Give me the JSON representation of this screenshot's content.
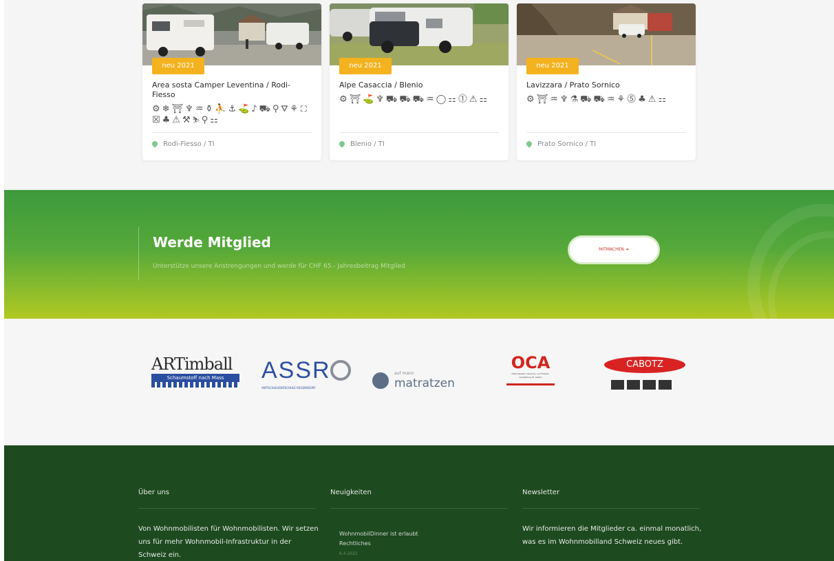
{
  "cards": [
    {
      "badge": "neu 2021",
      "title": "Area sosta Camper Leventina / Rodi-Fiesso",
      "icons": "⚙❄⛩♆♒⚱⛹⚓⛳♪⛟⚲⛛⚘⛶☒♣⚠⚒⛷⚲⚏",
      "location": "Rodi-Fiesso / TI"
    },
    {
      "badge": "neu 2021",
      "title": "Alpe Casaccia / Blenio",
      "icons": "⚙⛩⛳♆⛟⛟⛟♒◯⚏⓵⚠⚏",
      "location": "Blenio / TI"
    },
    {
      "badge": "neu 2021",
      "title": "Lavizzara / Prato Sornico",
      "icons": "⚙⛩♒♆⚗⛟⛟♒⚘⓹♣⚠⚏",
      "location": "Prato Sornico / TI"
    }
  ],
  "banner": {
    "title": "Werde Mitglied",
    "subtitle": "Unterstütze unsere Anstrengungen und werde für CHF 65.- Jahresbeitrag Mitglied",
    "button_label": "MITMACHEN ➔",
    "colors": {
      "top": "#3d9a3c",
      "bottom": "#b2c823"
    }
  },
  "sponsors": {
    "artimball": {
      "name": "ARTimball",
      "tagline": "Schaumstoff nach Mass"
    },
    "assr": {
      "name": "ASSR",
      "tagline": "ANTISCHLEUDERSCHULE REGENSDORF"
    },
    "matratzen": {
      "pre": "auf mann",
      "name": "matratzen"
    },
    "oca": {
      "name": "OCA",
      "tagline": "Ostschweizer Camping- und Freizeit-Ausstellung St. Gallen"
    },
    "cabotz": {
      "name": "CABOTZ"
    }
  },
  "footer": {
    "about_heading": "Über uns",
    "about_text": "Von Wohnmobilisten für Wohnmobilisten. Wir setzen uns für mehr Wohnmobil-Infrastruktur in der Schweiz ein.",
    "news_heading": "Neuigkeiten",
    "news_item_title": "WohnmobilDinner ist erlaubt",
    "news_item_category": "Rechtliches",
    "news_item_date": "6.4.2021",
    "newsletter_heading": "Newsletter",
    "newsletter_text": "Wir informieren die Mitglieder ca. einmal monatlich, was es im Wohnmobilland Schweiz neues gibt."
  }
}
